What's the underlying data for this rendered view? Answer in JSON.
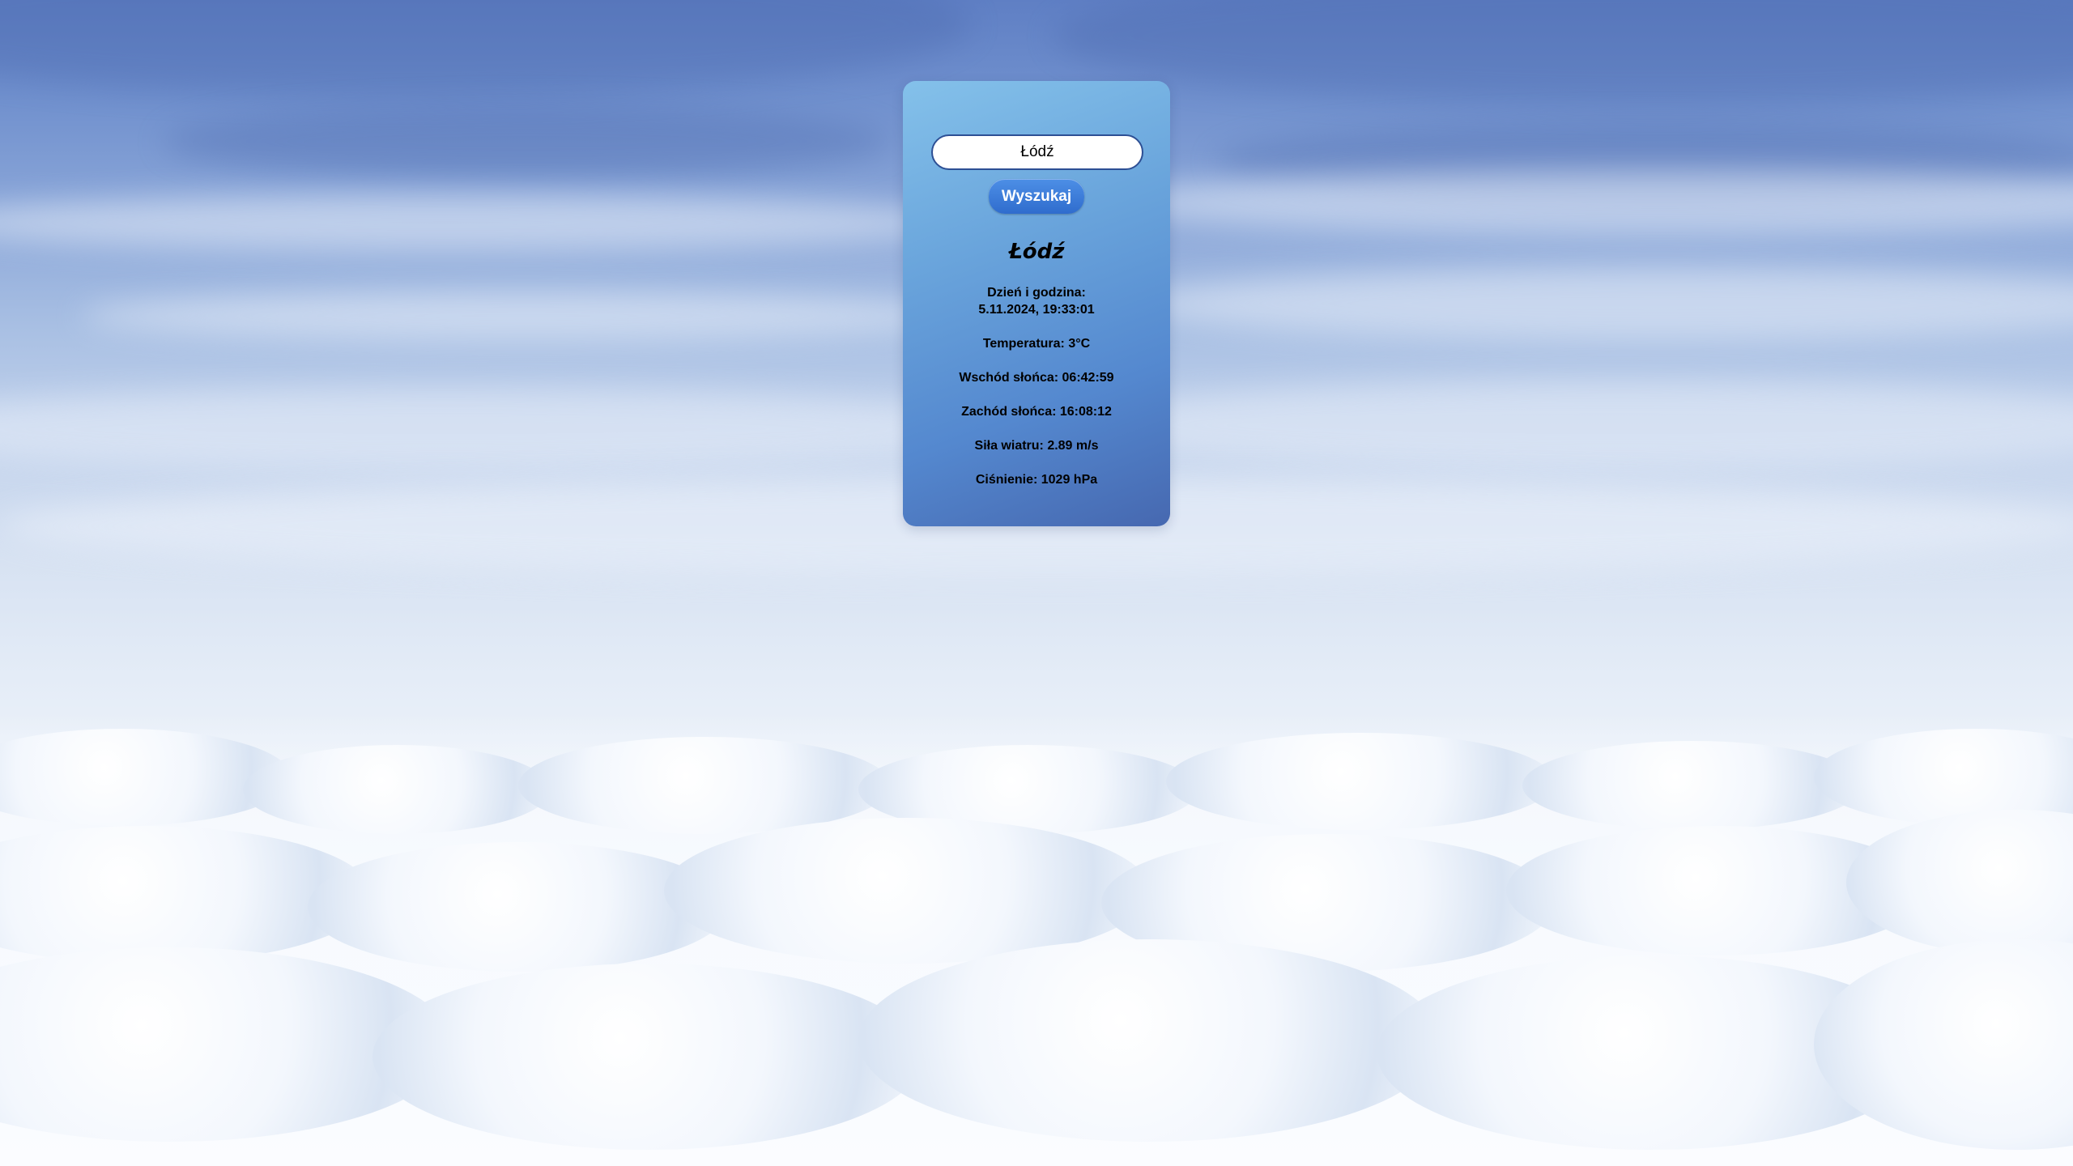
{
  "search": {
    "value": "Łódź",
    "button_label": "Wyszukaj"
  },
  "weather": {
    "city": "Łódź",
    "datetime_label": "Dzień i godzina:",
    "datetime_value": "5.11.2024, 19:33:01",
    "temperature": "Temperatura: 3°C",
    "sunrise": "Wschód słońca: 06:42:59",
    "sunset": "Zachód słońca: 16:08:12",
    "wind": "Siła wiatru: 2.89 m/s",
    "pressure": "Ciśnienie: 1029 hPa"
  },
  "colors": {
    "card_top": "#84c1ea",
    "card_bottom": "#4668b0",
    "button": "#3a7bd8"
  }
}
